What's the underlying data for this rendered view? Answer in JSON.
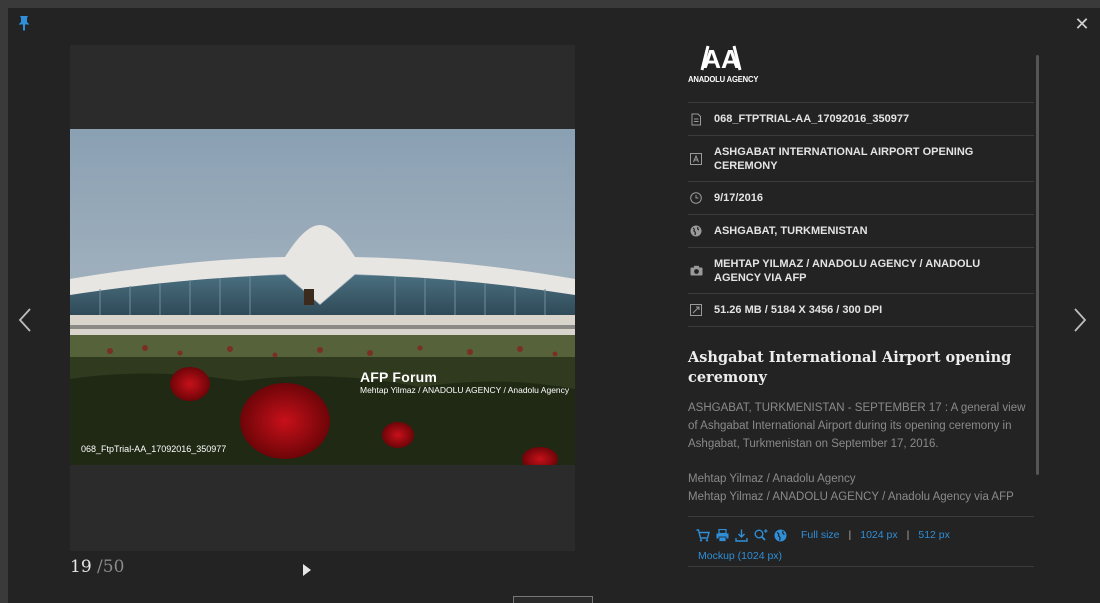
{
  "viewer": {
    "watermark_brand": "AFP Forum",
    "watermark_credit": "Mehtap Yilmaz / ANADOLU AGENCY / Anadolu Agency",
    "watermark_file": "068_FtpTrial-AA_17092016_350977",
    "counter_current": "19",
    "counter_total": "/50"
  },
  "agency": {
    "logo_mark": "AA",
    "logo_name": "ANADOLU AGENCY"
  },
  "meta": {
    "file_id": "068_FTPTRIAL-AA_17092016_350977",
    "headline": "ASHGABAT INTERNATIONAL AIRPORT OPENING CEREMONY",
    "date": "9/17/2016",
    "location": "ASHGABAT, TURKMENISTAN",
    "photographer": "MEHTAP YILMAZ / ANADOLU AGENCY / ANADOLU AGENCY VIA AFP",
    "size": "51.26 Mb / 5184 x 3456 / 300 dpi"
  },
  "article": {
    "title": "Ashgabat International Airport opening ceremony",
    "caption": "ASHGABAT, TURKMENISTAN - SEPTEMBER 17 : A general view of Ashgabat International Airport during its opening ceremony in Ashgabat, Turkmenistan on September 17, 2016.",
    "credit_line1": "Mehtap Yilmaz / Anadolu Agency",
    "credit_line2": "Mehtap Yilmaz / ANADOLU AGENCY / Anadolu Agency via AFP"
  },
  "actions": {
    "full_size": "Full size",
    "size_1024": "1024 px",
    "size_512": "512 px",
    "separator": "|",
    "mockup": "Mockup (1024 px)"
  },
  "colors": {
    "accent": "#2f8fd8",
    "background": "#232323"
  },
  "icons": [
    "pin-icon",
    "close-icon",
    "chevron-left-icon",
    "chevron-right-icon",
    "play-icon",
    "file-icon",
    "headline-icon",
    "clock-icon",
    "globe-icon",
    "camera-icon",
    "resize-icon",
    "cart-icon",
    "print-icon",
    "download-icon",
    "zoom-in-icon",
    "share-globe-icon"
  ]
}
